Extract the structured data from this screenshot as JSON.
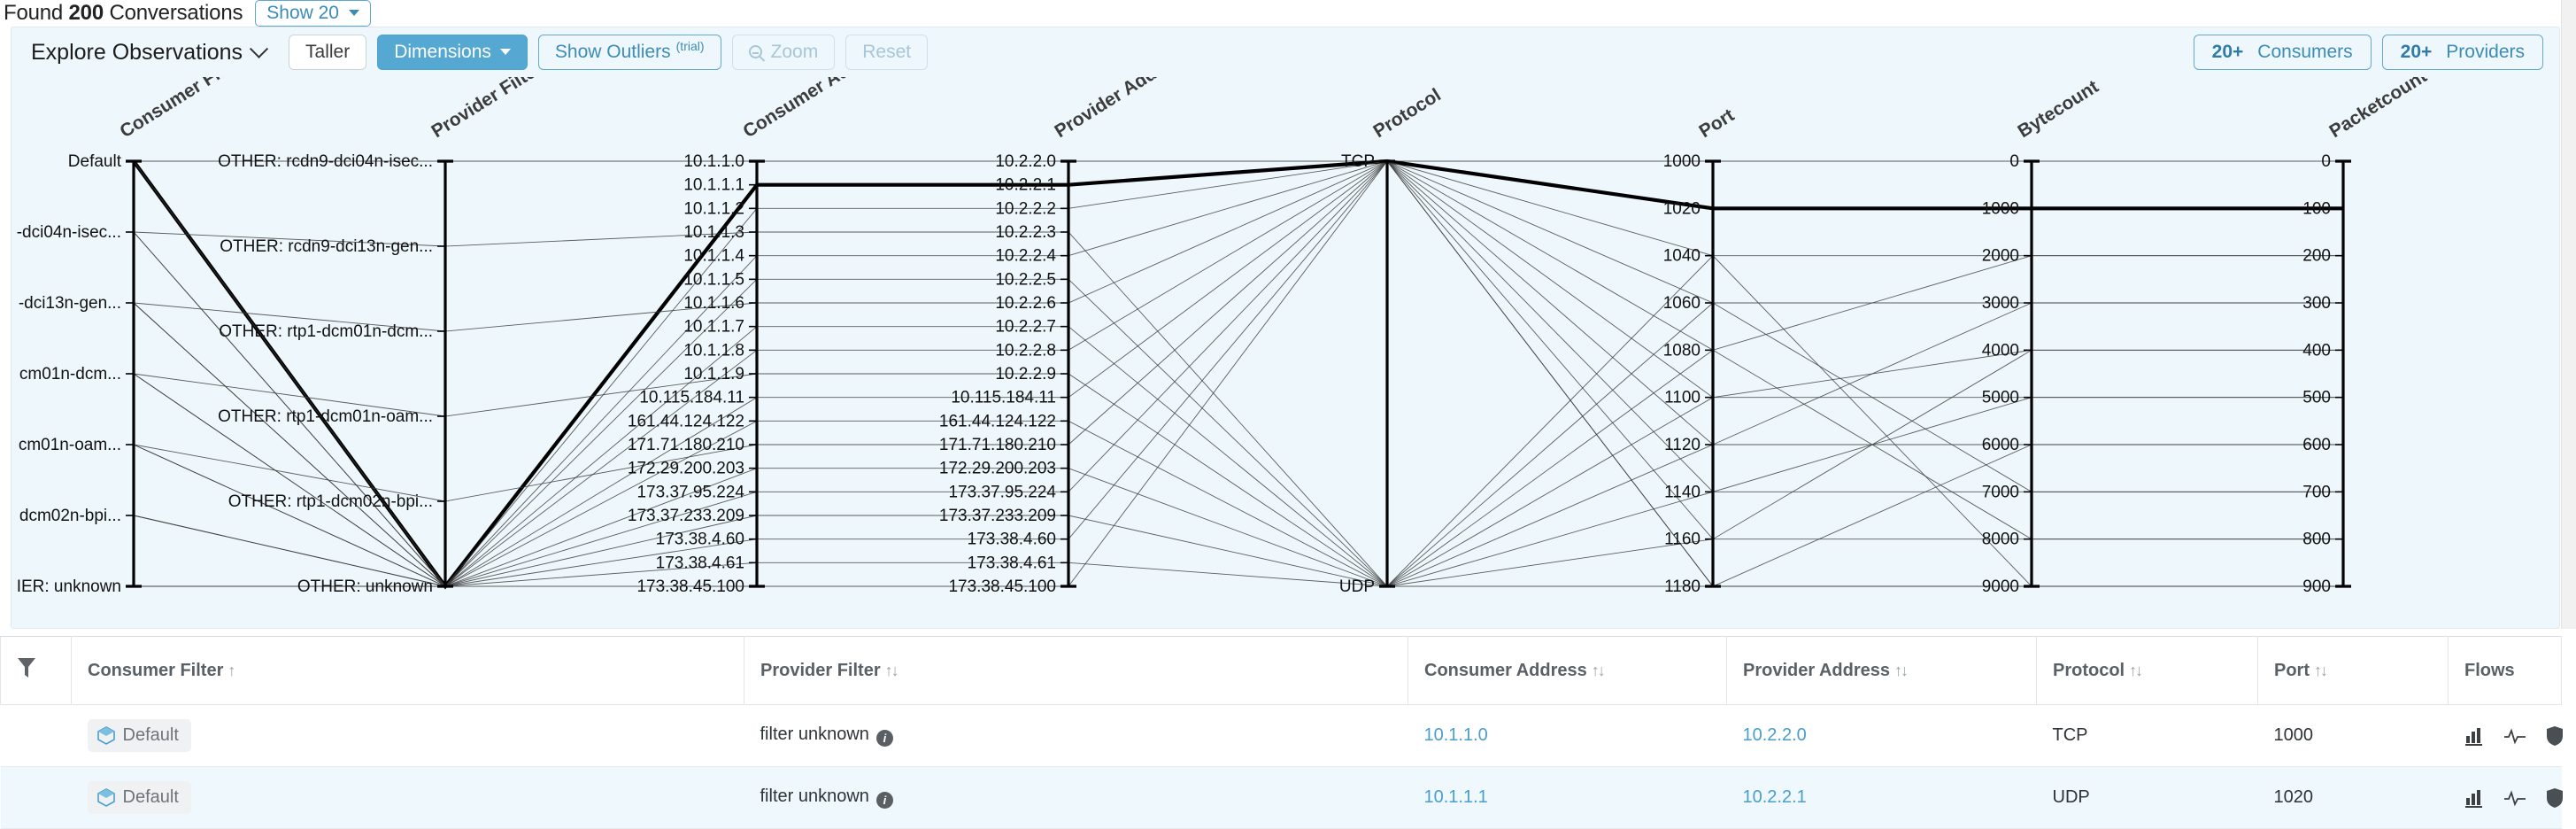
{
  "topbar": {
    "found_prefix": "Found ",
    "found_count": "200",
    "found_suffix": " Conversations",
    "show_label": "Show 20"
  },
  "explore": {
    "title": "Explore Observations",
    "buttons": {
      "taller": "Taller",
      "dimensions": "Dimensions",
      "show_outliers": "Show Outliers",
      "show_outliers_sup": "(trial)",
      "zoom": "Zoom",
      "reset": "Reset"
    },
    "consumers": {
      "count": "20+",
      "label": "Consumers"
    },
    "providers": {
      "count": "20+",
      "label": "Providers"
    }
  },
  "chart_data": {
    "type": "line",
    "title": "Explore Observations",
    "subtype": "parallel-coordinates",
    "axes": [
      {
        "name": "Consumer Filter",
        "kind": "categorical",
        "ticks": [
          "Default",
          "-dci04n-isec...",
          "-dci13n-gen...",
          "cm01n-dcm...",
          "cm01n-oam...",
          "dcm02n-bpi...",
          "IER: unknown"
        ]
      },
      {
        "name": "Provider Filter",
        "kind": "categorical",
        "ticks": [
          "OTHER: rcdn9-dci04n-isec...",
          "OTHER: rcdn9-dci13n-gen...",
          "OTHER: rtp1-dcm01n-dcm...",
          "OTHER: rtp1-dcm01n-oam...",
          "OTHER: rtp1-dcm02n-bpi...",
          "OTHER: unknown"
        ]
      },
      {
        "name": "Consumer Address",
        "kind": "categorical",
        "ticks": [
          "10.1.1.0",
          "10.1.1.1",
          "10.1.1.2",
          "10.1.1.3",
          "10.1.1.4",
          "10.1.1.5",
          "10.1.1.6",
          "10.1.1.7",
          "10.1.1.8",
          "10.1.1.9",
          "10.115.184.11",
          "161.44.124.122",
          "171.71.180.210",
          "172.29.200.203",
          "173.37.95.224",
          "173.37.233.209",
          "173.38.4.60",
          "173.38.4.61",
          "173.38.45.100"
        ]
      },
      {
        "name": "Provider Address",
        "kind": "categorical",
        "ticks": [
          "10.2.2.0",
          "10.2.2.1",
          "10.2.2.2",
          "10.2.2.3",
          "10.2.2.4",
          "10.2.2.5",
          "10.2.2.6",
          "10.2.2.7",
          "10.2.2.8",
          "10.2.2.9",
          "10.115.184.11",
          "161.44.124.122",
          "171.71.180.210",
          "172.29.200.203",
          "173.37.95.224",
          "173.37.233.209",
          "173.38.4.60",
          "173.38.4.61",
          "173.38.45.100"
        ]
      },
      {
        "name": "Protocol",
        "kind": "categorical",
        "ticks": [
          "TCP",
          "UDP"
        ]
      },
      {
        "name": "Port",
        "kind": "numeric",
        "ticks": [
          "1000",
          "1020",
          "1040",
          "1060",
          "1080",
          "1100",
          "1120",
          "1140",
          "1160",
          "1180"
        ],
        "range": [
          1000,
          1180
        ]
      },
      {
        "name": "Bytecount",
        "kind": "numeric",
        "ticks": [
          "0",
          "1000",
          "2000",
          "3000",
          "4000",
          "5000",
          "6000",
          "7000",
          "8000",
          "9000"
        ],
        "range": [
          0,
          9000
        ]
      },
      {
        "name": "Packetcount",
        "kind": "numeric",
        "ticks": [
          "0",
          "100",
          "200",
          "300",
          "400",
          "500",
          "600",
          "700",
          "800",
          "900"
        ],
        "range": [
          0,
          900
        ]
      }
    ],
    "records": [
      {
        "cf": 0,
        "pf": 0,
        "ca": 0,
        "pa": 0,
        "pr": 0,
        "port": 0,
        "byte": 0,
        "pkt": 0,
        "hl": false
      },
      {
        "cf": 0,
        "pf": 5,
        "ca": 1,
        "pa": 1,
        "pr": 0,
        "port": 1,
        "byte": 1,
        "pkt": 1,
        "hl": true
      },
      {
        "cf": 0,
        "pf": 5,
        "ca": 2,
        "pa": 2,
        "pr": 0,
        "port": 2,
        "byte": 2,
        "pkt": 2,
        "hl": false
      },
      {
        "cf": 1,
        "pf": 1,
        "ca": 3,
        "pa": 3,
        "pr": 1,
        "port": 3,
        "byte": 3,
        "pkt": 3,
        "hl": false
      },
      {
        "cf": 1,
        "pf": 5,
        "ca": 4,
        "pa": 4,
        "pr": 0,
        "port": 4,
        "byte": 2,
        "pkt": 2,
        "hl": false
      },
      {
        "cf": 1,
        "pf": 5,
        "ca": 5,
        "pa": 5,
        "pr": 1,
        "port": 5,
        "byte": 4,
        "pkt": 4,
        "hl": false
      },
      {
        "cf": 2,
        "pf": 2,
        "ca": 6,
        "pa": 6,
        "pr": 0,
        "port": 6,
        "byte": 3,
        "pkt": 3,
        "hl": false
      },
      {
        "cf": 2,
        "pf": 5,
        "ca": 7,
        "pa": 7,
        "pr": 1,
        "port": 7,
        "byte": 5,
        "pkt": 5,
        "hl": false
      },
      {
        "cf": 2,
        "pf": 5,
        "ca": 8,
        "pa": 8,
        "pr": 0,
        "port": 8,
        "byte": 4,
        "pkt": 4,
        "hl": false
      },
      {
        "cf": 3,
        "pf": 3,
        "ca": 9,
        "pa": 9,
        "pr": 1,
        "port": 9,
        "byte": 6,
        "pkt": 6,
        "hl": false
      },
      {
        "cf": 3,
        "pf": 5,
        "ca": 10,
        "pa": 10,
        "pr": 0,
        "port": 5,
        "byte": 5,
        "pkt": 5,
        "hl": false
      },
      {
        "cf": 3,
        "pf": 5,
        "ca": 11,
        "pa": 11,
        "pr": 1,
        "port": 6,
        "byte": 6,
        "pkt": 6,
        "hl": false
      },
      {
        "cf": 4,
        "pf": 4,
        "ca": 12,
        "pa": 12,
        "pr": 0,
        "port": 7,
        "byte": 7,
        "pkt": 7,
        "hl": false
      },
      {
        "cf": 4,
        "pf": 5,
        "ca": 13,
        "pa": 13,
        "pr": 1,
        "port": 8,
        "byte": 8,
        "pkt": 8,
        "hl": false
      },
      {
        "cf": 4,
        "pf": 5,
        "ca": 14,
        "pa": 14,
        "pr": 0,
        "port": 3,
        "byte": 7,
        "pkt": 7,
        "hl": false
      },
      {
        "cf": 5,
        "pf": 5,
        "ca": 15,
        "pa": 15,
        "pr": 1,
        "port": 4,
        "byte": 8,
        "pkt": 8,
        "hl": false
      },
      {
        "cf": 5,
        "pf": 5,
        "ca": 16,
        "pa": 16,
        "pr": 0,
        "port": 9,
        "byte": 9,
        "pkt": 9,
        "hl": false
      },
      {
        "cf": 6,
        "pf": 5,
        "ca": 17,
        "pa": 17,
        "pr": 1,
        "port": 2,
        "byte": 9,
        "pkt": 9,
        "hl": false
      },
      {
        "cf": 6,
        "pf": 5,
        "ca": 18,
        "pa": 18,
        "pr": 0,
        "port": 9,
        "byte": 9,
        "pkt": 9,
        "hl": false
      }
    ]
  },
  "table": {
    "columns": [
      {
        "label": "",
        "sort": ""
      },
      {
        "label": "Consumer Filter",
        "sort": "↑"
      },
      {
        "label": "Provider Filter",
        "sort": "↑↓"
      },
      {
        "label": "Consumer Address",
        "sort": "↑↓"
      },
      {
        "label": "Provider Address",
        "sort": "↑↓"
      },
      {
        "label": "Protocol",
        "sort": "↑↓"
      },
      {
        "label": "Port",
        "sort": "↑↓"
      },
      {
        "label": "Flows",
        "sort": ""
      }
    ],
    "rows": [
      {
        "consumer_filter": "Default",
        "provider_filter": "filter unknown",
        "consumer_address": "10.1.1.0",
        "provider_address": "10.2.2.0",
        "protocol": "TCP",
        "port": "1000"
      },
      {
        "consumer_filter": "Default",
        "provider_filter": "filter unknown",
        "consumer_address": "10.1.1.1",
        "provider_address": "10.2.2.1",
        "protocol": "UDP",
        "port": "1020"
      }
    ]
  }
}
